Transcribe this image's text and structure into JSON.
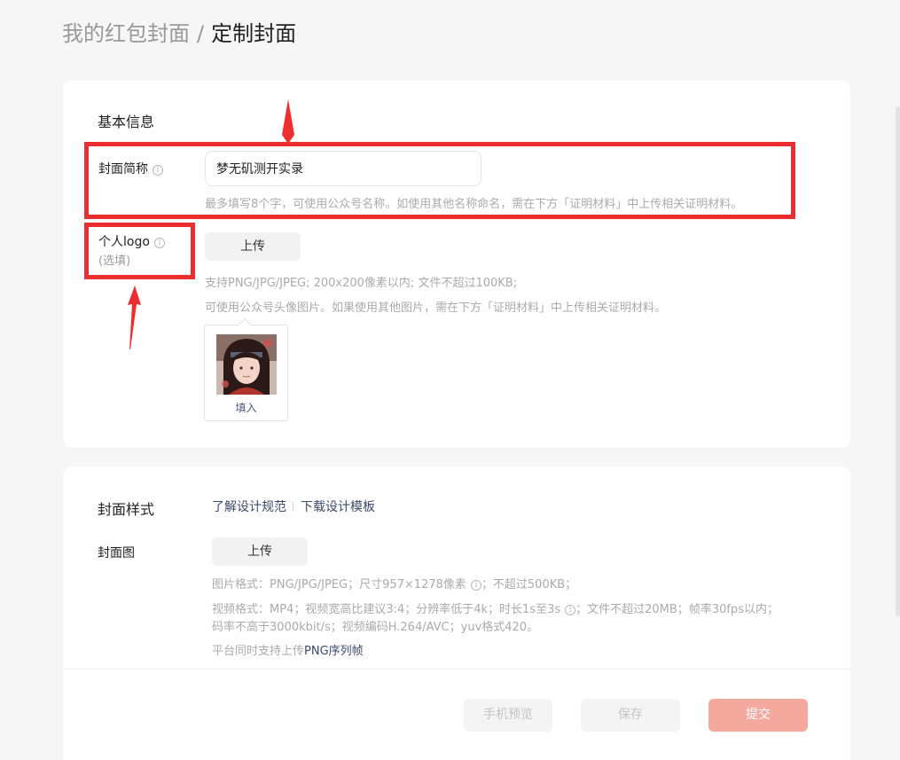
{
  "breadcrumb": {
    "parent": "我的红包封面",
    "separator": "/",
    "current": "定制封面"
  },
  "basic_info": {
    "title": "基本信息",
    "cover_name": {
      "label": "封面简称",
      "info_icon": "ⓘ",
      "value": "梦无矶测开实录",
      "hint": "最多填写8个字，可使用公众号名称。如使用其他名称命名，需在下方「证明材料」中上传相关证明材料。"
    },
    "personal_logo": {
      "label": "个人logo",
      "info_icon": "ⓘ",
      "optional": "(选填)",
      "upload_button": "上传",
      "hint_format": "支持PNG/JPG/JPEG; 200x200像素以内; 文件不超过100KB;",
      "hint_usage": "可使用公众号头像图片。如果使用其他图片，需在下方「证明材料」中上传相关证明材料。",
      "fill_caption": "填入"
    }
  },
  "cover_style": {
    "title": "封面样式",
    "link_spec": "了解设计规范",
    "link_template": "下载设计模板",
    "cover_image": {
      "label": "封面图",
      "upload_button": "上传",
      "hint_image": "图片格式：PNG/JPG/JPEG；尺寸957×1278像素",
      "hint_image_tail": "；不超过500KB；",
      "hint_video_line1_a": "视频格式：MP4；视频宽高比建议3:4；分辨率低于4k；时长1s至3s",
      "hint_video_line1_b": "；文件不超过20MB；帧率30fps以内；",
      "hint_video_line2": "码率不高于3000kbit/s；视频编码H.264/AVC；yuv格式420。",
      "hint_png_prefix": "平台同时支持上传",
      "hint_png_link": "PNG序列帧"
    }
  },
  "footer": {
    "preview_button": "手机预览",
    "save_button": "保存",
    "submit_button": "提交"
  },
  "icons": {
    "info": "info-icon"
  },
  "colors": {
    "annotation_red": "#ee2e2e",
    "submit_disabled": "#f5a89e",
    "link": "#3c4a6b"
  }
}
